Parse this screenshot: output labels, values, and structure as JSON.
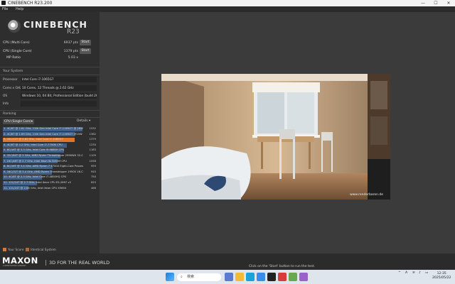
{
  "window": {
    "title": "CINEBENCH R23.200",
    "minimize": "—",
    "maximize": "☐",
    "close": "✕"
  },
  "menu": [
    "File",
    "Help"
  ],
  "logo": {
    "name": "CINEBENCH",
    "version": "R23"
  },
  "scores": [
    {
      "label": "CPU (Multi Core)",
      "value": "6937 pts",
      "button": "Start"
    },
    {
      "label": "CPU (Single Core)",
      "value": "1379 pts",
      "button": "Start"
    },
    {
      "label": "MP Ratio",
      "value": "5.03 x"
    }
  ],
  "system": {
    "heading": "Your System",
    "rows": [
      {
        "key": "Processor",
        "value": "Intel Core i7-1065G7"
      },
      {
        "key": "Cores x GHz",
        "value": "10 Cores, 12 Threads @ 2.62 GHz"
      },
      {
        "key": "OS",
        "value": "Windows 10, 64 Bit, Professional Edition (build 26100)"
      },
      {
        "key": "Info",
        "value": ""
      }
    ]
  },
  "ranking": {
    "heading": "Ranking",
    "selected": "CPU (Single Core)",
    "details": "Details",
    "max_score": 1532,
    "items": [
      {
        "text": "1. 4C/8T @ 2.81 GHz, 11th Gen Intel Core i7-1165G7 @ 28W",
        "score": "1532",
        "value": 1532,
        "mine": false
      },
      {
        "text": "2. 4C/8T @ 1.69 GHz, 11th Gen Intel Core i7-1165G7 @15W",
        "score": "1382",
        "value": 1382,
        "mine": false
      },
      {
        "text": "3. 10C/12T @ 2.62 GHz, Intel Core i7-1065G7",
        "score": "1379",
        "value": 1379,
        "mine": true
      },
      {
        "text": "4. 4C/8T @ 4.2 GHz, Intel Core i7-7700K CPU",
        "score": "1230",
        "value": 1230,
        "mine": false
      },
      {
        "text": "5. 8C/16T @ 3.3 GHz, Intel Core i9-9880H CPU",
        "score": "1183",
        "value": 1183,
        "mine": false
      },
      {
        "text": "6. 32C/64T @ 3 GHz, AMD Ryzen Threadripper 2990WX 32-Core",
        "score": "1109",
        "value": 1109,
        "mine": false
      },
      {
        "text": "7. 24C/48T @ 2.7 GHz, Intel Xeon W-3265M CPU",
        "score": "1058",
        "value": 1058,
        "mine": false
      },
      {
        "text": "8. 8C/16T @ 3.4 GHz, AMD Ryzen 7 1700X Eight-Core Processor",
        "score": "959",
        "value": 959,
        "mine": false
      },
      {
        "text": "9. 16C/32T @ 3.4 GHz, AMD Ryzen Threadripper 1950X 16-Core",
        "score": "945",
        "value": 945,
        "mine": false
      },
      {
        "text": "10. 4C/8T @ 2.3 GHz, Intel Core i7-4850HQ CPU",
        "score": "750",
        "value": 750,
        "mine": false
      },
      {
        "text": "11. 12C/24T @ 2.7 GHz, Intel Xeon CPU E5-2697 v2",
        "score": "653",
        "value": 653,
        "mine": false
      },
      {
        "text": "12. 12C/24T @ 2.66 GHz, Intel Xeon CPU X5650",
        "score": "486",
        "value": 486,
        "mine": false
      }
    ]
  },
  "legend": {
    "your_score": "Your Score",
    "identical": "Identical System"
  },
  "footer": {
    "brand": "MAXON",
    "brand_sub": "A NEMETSCHEK COMPANY",
    "tagline": "3D FOR THE REAL WORLD",
    "status": "Click on the 'Start' button to run the test."
  },
  "render": {
    "watermark": "www.renderbaron.de"
  },
  "taskbar": {
    "search_placeholder": "検索",
    "tray_chevron": "^",
    "ime": "A",
    "time": "12:35",
    "date": "2025/05/22"
  },
  "colors": {
    "accent": "#e0762a",
    "bar": "#3f5f86"
  }
}
